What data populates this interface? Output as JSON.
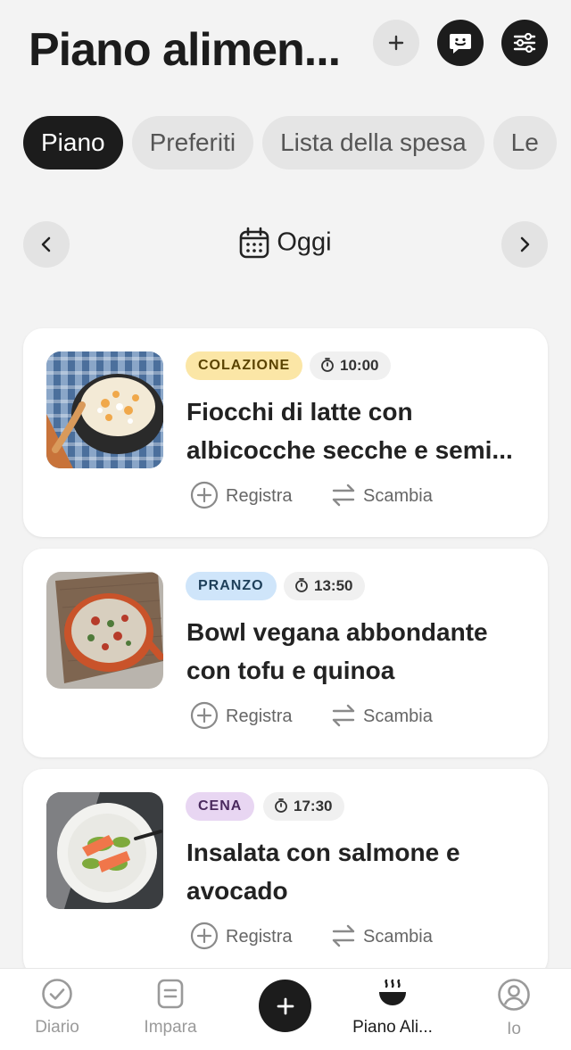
{
  "header": {
    "title": "Piano alimen...",
    "actions": [
      "plus-icon",
      "chat-smile-icon",
      "sliders-icon"
    ]
  },
  "tabs": [
    {
      "label": "Piano",
      "active": true
    },
    {
      "label": "Preferiti",
      "active": false
    },
    {
      "label": "Lista della spesa",
      "active": false
    },
    {
      "label": "Le",
      "active": false
    }
  ],
  "date_nav": {
    "label": "Oggi"
  },
  "meals": [
    {
      "badge": "COLAZIONE",
      "badge_bg": "#fbe6a6",
      "badge_color": "#5a4300",
      "time": "10:00",
      "title_line1": "Fiocchi di latte con",
      "title_line2": "albicocche secche e semi...",
      "register_label": "Registra",
      "swap_label": "Scambia"
    },
    {
      "badge": "PRANZO",
      "badge_bg": "#cfe5fa",
      "badge_color": "#1e3f5a",
      "time": "13:50",
      "title_line1": "Bowl vegana abbondante",
      "title_line2": "con tofu e quinoa",
      "register_label": "Registra",
      "swap_label": "Scambia"
    },
    {
      "badge": "CENA",
      "badge_bg": "#e8d6f2",
      "badge_color": "#4a2a5e",
      "time": "17:30",
      "title_line1": "Insalata con salmone e",
      "title_line2": "avocado",
      "register_label": "Registra",
      "swap_label": "Scambia"
    }
  ],
  "bottom_nav": [
    {
      "label": "Diario",
      "icon": "check-circle-icon",
      "active": false
    },
    {
      "label": "Impara",
      "icon": "document-icon",
      "active": false
    },
    {
      "label": "",
      "icon": "plus-icon",
      "active": false
    },
    {
      "label": "Piano Ali...",
      "icon": "bowl-steam-icon",
      "active": true
    },
    {
      "label": "Io",
      "icon": "user-circle-icon",
      "active": false
    }
  ]
}
